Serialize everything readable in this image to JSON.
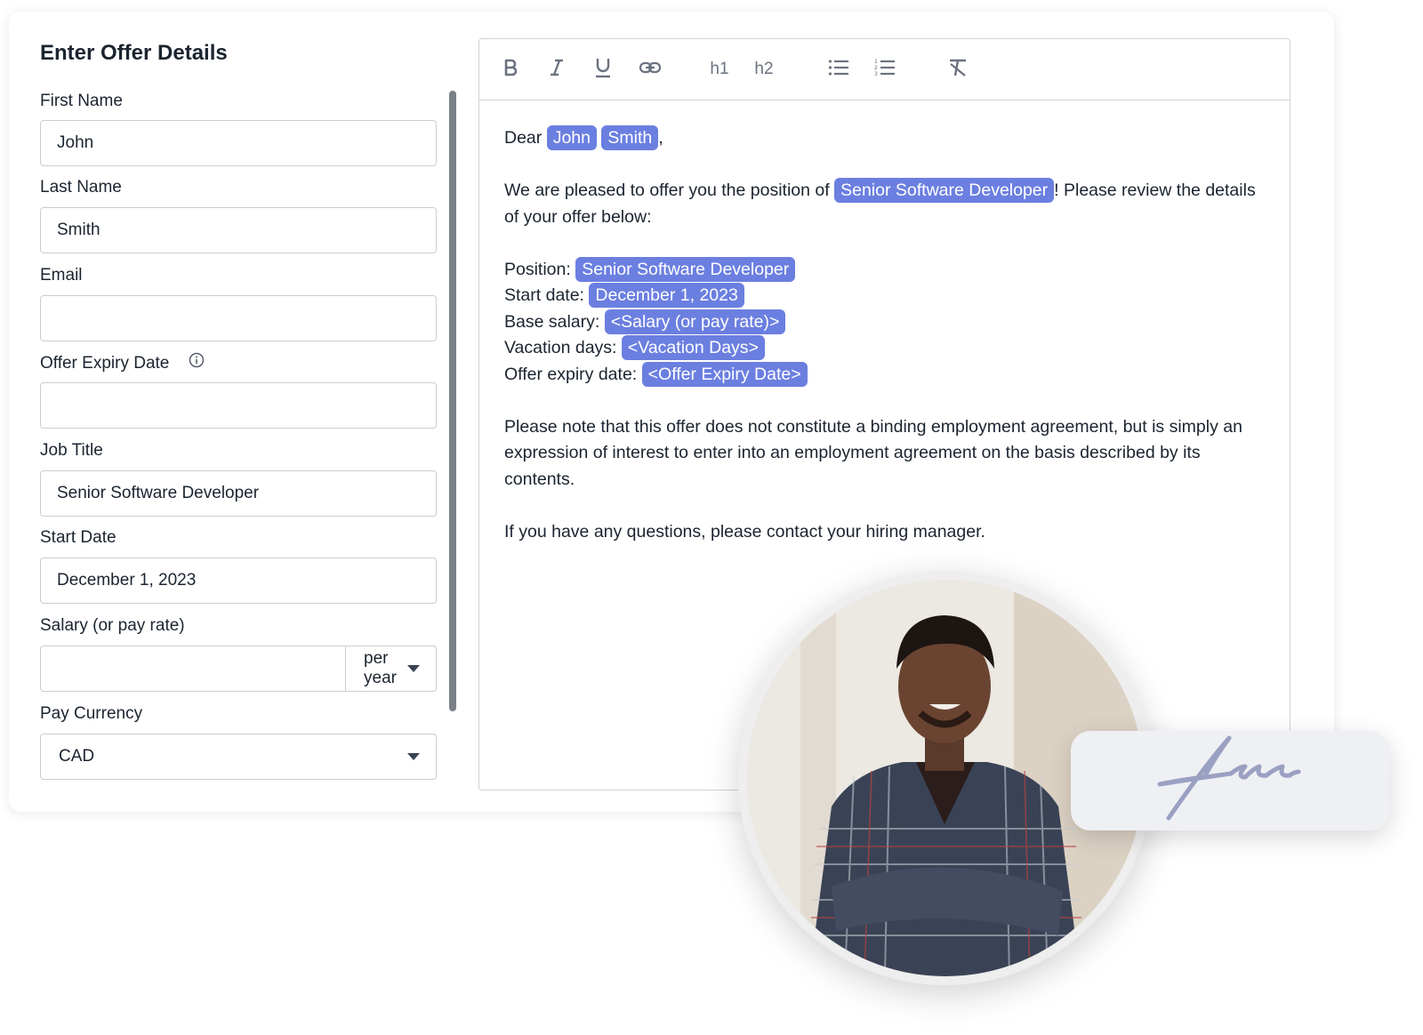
{
  "form": {
    "title": "Enter Offer Details",
    "first_name": {
      "label": "First Name",
      "value": "John"
    },
    "last_name": {
      "label": "Last Name",
      "value": "Smith"
    },
    "email": {
      "label": "Email",
      "value": ""
    },
    "offer_expiry": {
      "label": "Offer Expiry Date",
      "value": ""
    },
    "job_title": {
      "label": "Job Title",
      "value": "Senior Software Developer"
    },
    "start_date": {
      "label": "Start Date",
      "value": "December 1, 2023"
    },
    "salary": {
      "label": "Salary (or pay rate)",
      "value": "",
      "period": "per year"
    },
    "pay_currency": {
      "label": "Pay Currency",
      "value": "CAD"
    }
  },
  "toolbar": {
    "h1": "h1",
    "h2": "h2",
    "buttons": [
      "bold-icon",
      "italic-icon",
      "underline-icon",
      "link-icon",
      "h1",
      "h2",
      "bullet-list-icon",
      "numbered-list-icon",
      "clear-format-icon"
    ]
  },
  "letter": {
    "greeting": "Dear",
    "first_name": "John",
    "last_name": "Smith",
    "intro_before": "We are pleased to offer you the position of",
    "intro_position": "Senior Software Developer",
    "intro_after": "! Please review the details of your offer below:",
    "position_label": "Position:",
    "position_value": "Senior Software Developer",
    "start_label": "Start date:",
    "start_value": "December 1, 2023",
    "salary_label": "Base salary:",
    "salary_value": "<Salary (or pay rate)>",
    "vacation_label": "Vacation days:",
    "vacation_value": "<Vacation Days>",
    "expiry_label": "Offer expiry date:",
    "expiry_value": "<Offer Expiry Date>",
    "note": "Please note that this offer does not constitute a binding employment agreement, but is simply an expression of interest to enter into an employment agreement on the basis described by its contents.",
    "closing": "If you have any questions, please contact your hiring manager."
  },
  "colors": {
    "chip": "#6b7fe0",
    "border": "#c9cdd3",
    "text": "#1b2430"
  }
}
